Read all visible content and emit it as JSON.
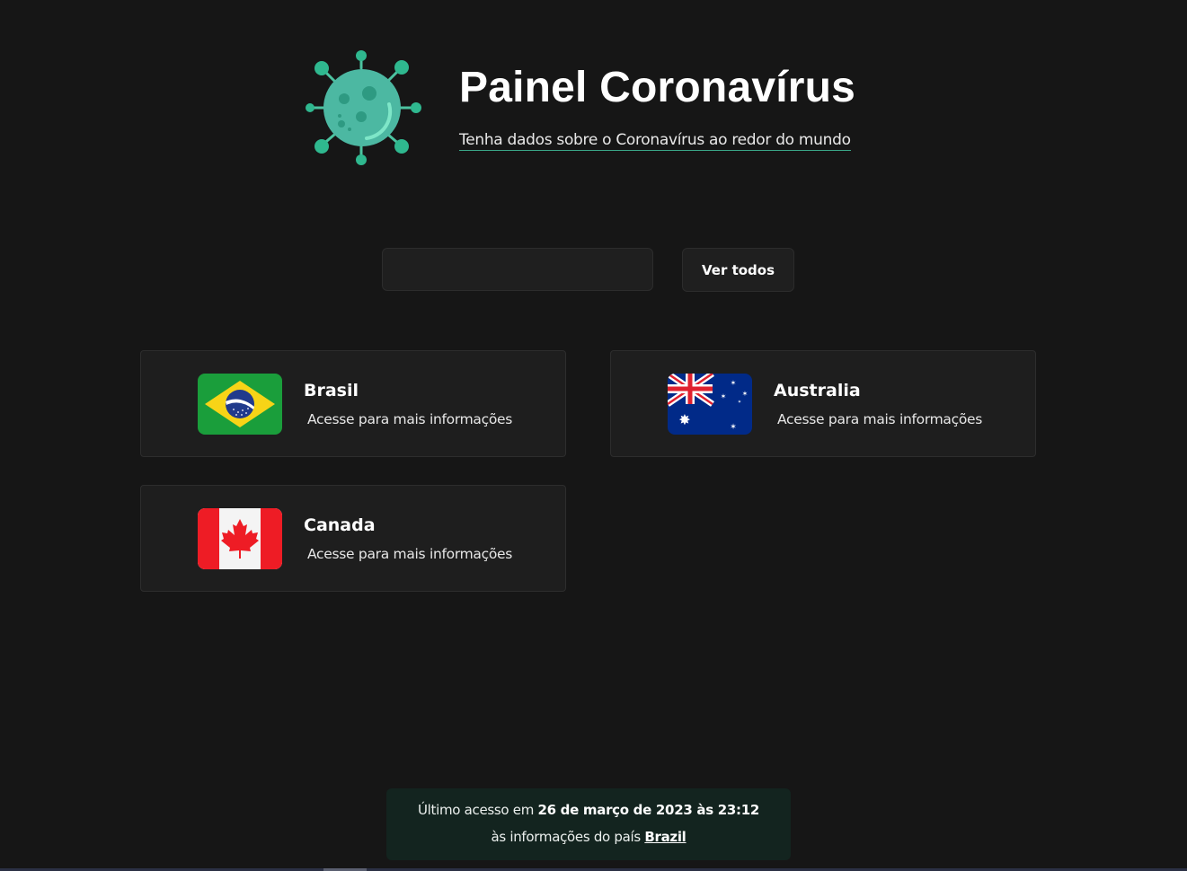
{
  "header": {
    "title": "Painel Coronavírus",
    "subtitle": "Tenha dados sobre o Coronavírus ao redor do mundo",
    "logo_icon": "virus-icon"
  },
  "search": {
    "value": "",
    "placeholder": "",
    "view_all_label": "Ver todos"
  },
  "countries": [
    {
      "name": "Brasil",
      "description": "Acesse para mais informações",
      "flag_icon": "brazil-flag-icon"
    },
    {
      "name": "Australia",
      "description": "Acesse para mais informações",
      "flag_icon": "australia-flag-icon"
    },
    {
      "name": "Canada",
      "description": "Acesse para mais informações",
      "flag_icon": "canada-flag-icon"
    }
  ],
  "last_access": {
    "prefix": "Último acesso em",
    "datetime": "26 de março de 2023 às 23:12",
    "line2_prefix": "às informações do país",
    "country": "Brazil"
  },
  "colors": {
    "background": "#161616",
    "card": "#1e1e1e",
    "accent": "#3aa889",
    "footer_bg": "#13241f"
  }
}
